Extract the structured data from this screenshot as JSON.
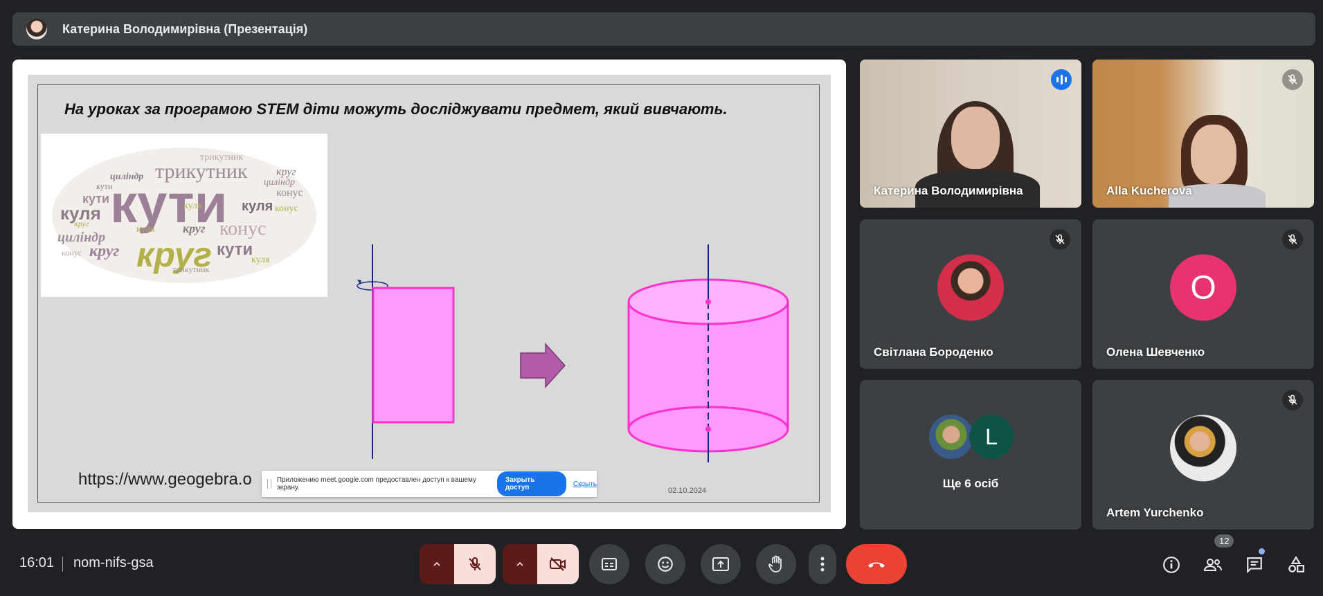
{
  "header": {
    "presenter_title": "Катерина Володимирівна (Презентація)"
  },
  "slide": {
    "heading": "На уроках за програмою STEM діти можуть досліджувати предмет, який вивчають.",
    "url": "https://www.geogebra.o",
    "date": "02.10.2024",
    "wordcloud": {
      "words": [
        "трикутник",
        "кути",
        "куля",
        "конус",
        "циліндр",
        "круг",
        "куля",
        "конус",
        "круг",
        "кути",
        "круг",
        "циліндр",
        "трикутник",
        "конус",
        "кути",
        "куля",
        "круг",
        "куля",
        "циліндр",
        "конус",
        "трикутник",
        "кути",
        "куля",
        "круг"
      ]
    }
  },
  "share_banner": {
    "text": "Приложению meet.google.com предоставлен доступ к вашему экрану.",
    "stop_button": "Закрыть доступ",
    "hide_link": "Скрыть"
  },
  "participants": [
    {
      "name": "Катерина Володимирівна",
      "status": "speaking"
    },
    {
      "name": "Alla Kucherova",
      "status": "muted"
    },
    {
      "name": "Світлана Бороденко",
      "status": "muted"
    },
    {
      "name": "Олена Шевченко",
      "status": "muted",
      "initial": "O"
    },
    {
      "name": "Ще 6 осіб",
      "initial": "L"
    },
    {
      "name": "Artem Yurchenko",
      "status": "muted"
    }
  ],
  "bottom": {
    "time": "16:01",
    "meeting_code": "nom-nifs-gsa",
    "participant_count": "12"
  },
  "colors": {
    "end_call": "#ea4335",
    "accent": "#1a73e8",
    "tile_bg": "#3c4043",
    "shape_pink": "#ff99ff"
  }
}
